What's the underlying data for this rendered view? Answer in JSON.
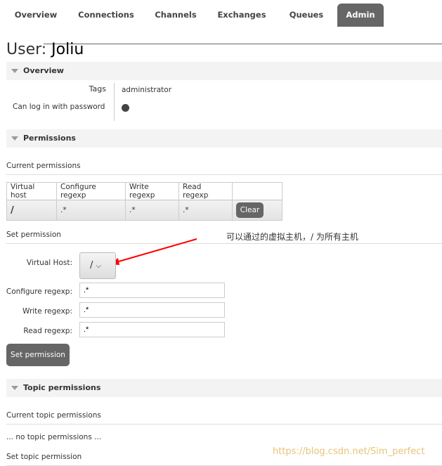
{
  "nav": {
    "tabs": [
      "Overview",
      "Connections",
      "Channels",
      "Exchanges",
      "Queues",
      "Admin"
    ],
    "active": "Admin"
  },
  "title": {
    "prefix": "User:",
    "name": "Joliu"
  },
  "overview": {
    "heading": "Overview",
    "tags_label": "Tags",
    "tags_value": "administrator",
    "password_label": "Can log in with password"
  },
  "permissions": {
    "heading": "Permissions",
    "current_label": "Current permissions",
    "columns": [
      "Virtual host",
      "Configure regexp",
      "Write regexp",
      "Read regexp",
      ""
    ],
    "rows": [
      {
        "vhost": "/",
        "configure": ".*",
        "write": ".*",
        "read": ".*",
        "action": "Clear"
      }
    ],
    "set_label": "Set permission",
    "form": {
      "vhost_label": "Virtual Host:",
      "vhost_value": "/",
      "configure_label": "Configure regexp:",
      "configure_value": ".*",
      "write_label": "Write regexp:",
      "write_value": ".*",
      "read_label": "Read regexp:",
      "read_value": ".*",
      "submit": "Set permission"
    }
  },
  "annotation": {
    "text": "可以通过的虚拟主机，/ 为所有主机",
    "color": "#ff0000"
  },
  "topic": {
    "heading": "Topic permissions",
    "current_label": "Current topic permissions",
    "empty": "... no topic permissions ...",
    "set_label": "Set topic permission"
  },
  "watermark": "https://blog.csdn.net/Sim_perfect"
}
